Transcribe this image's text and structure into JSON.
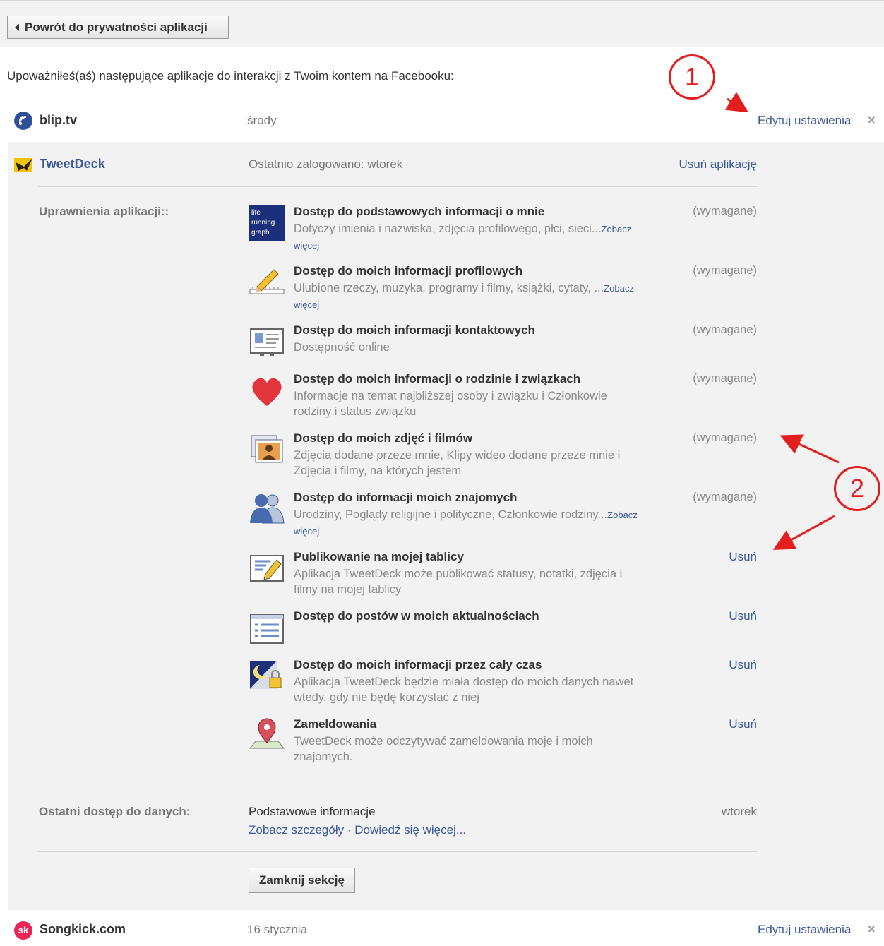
{
  "back_button": "Powrót do prywatności aplikacji",
  "intro": "Upoważniłeś(aś) następujące aplikacje do interakcji z Twoim kontem na Facebooku:",
  "apps": {
    "blip": {
      "icon": "blip-logo-icon",
      "name": "blip.tv",
      "last": "środy",
      "edit": "Edytuj ustawienia",
      "close": "×"
    },
    "tweetdeck": {
      "icon": "tweetdeck-logo-icon",
      "name": "TweetDeck",
      "last": "Ostatnio zalogowano: wtorek",
      "remove": "Usuń aplikację"
    },
    "songkick": {
      "icon": "songkick-logo-icon",
      "icon_text": "sk",
      "name": "Songkick.com",
      "last": "16 stycznia",
      "edit": "Edytuj ustawienia",
      "close": "×"
    }
  },
  "permissions_label": "Uprawnienia aplikacji::",
  "permissions": [
    {
      "icon": "life-running-graph-icon",
      "title": "Dostęp do podstawowych informacji o mnie",
      "desc": "Dotyczy imienia i nazwiska, zdjęcia profilowego, płci, sieci...",
      "more": "Zobacz więcej",
      "status": "(wymagane)"
    },
    {
      "icon": "pencil-ruler-icon",
      "title": "Dostęp do moich informacji profilowych",
      "desc": "Ulubione rzeczy, muzyka, programy i filmy, książki, cytaty, ...",
      "more": "Zobacz więcej",
      "status": "(wymagane)"
    },
    {
      "icon": "contact-card-icon",
      "title": "Dostęp do moich informacji kontaktowych",
      "desc": "Dostępność online",
      "more": "",
      "status": "(wymagane)"
    },
    {
      "icon": "heart-icon",
      "title": "Dostęp do moich informacji o rodzinie i związkach",
      "desc": "Informacje na temat najbliższej osoby i związku i Członkowie rodziny i status związku",
      "more": "",
      "status": "(wymagane)"
    },
    {
      "icon": "photos-icon",
      "title": "Dostęp do moich zdjęć i filmów",
      "desc": "Zdjęcia dodane przeze mnie, Klipy wideo dodane przeze mnie i Zdjęcia i filmy, na których jestem",
      "more": "",
      "status": "(wymagane)"
    },
    {
      "icon": "friends-icon",
      "title": "Dostęp do informacji moich znajomych",
      "desc": "Urodziny, Poglądy religijne i polityczne, Członkowie rodziny...",
      "more": "Zobacz więcej",
      "status": "(wymagane)"
    },
    {
      "icon": "wall-post-icon",
      "title": "Publikowanie na mojej tablicy",
      "desc": "Aplikacja TweetDeck może publikować statusy, notatki, zdjęcia i filmy na mojej tablicy",
      "more": "",
      "action": "Usuń"
    },
    {
      "icon": "news-feed-icon",
      "title": "Dostęp do postów w moich aktualnościach",
      "desc": "",
      "more": "",
      "action": "Usuń"
    },
    {
      "icon": "offline-access-icon",
      "title": "Dostęp do moich informacji przez cały czas",
      "desc": "Aplikacja TweetDeck będzie miała dostęp do moich danych nawet wtedy, gdy nie będę korzystać z niej",
      "more": "",
      "action": "Usuń"
    },
    {
      "icon": "map-pin-icon",
      "title": "Zameldowania",
      "desc": "TweetDeck może odczytywać zameldowania moje i moich znajomych.",
      "more": "",
      "action": "Usuń"
    }
  ],
  "last_access": {
    "label": "Ostatni dostęp do danych:",
    "value": "Podstawowe informacje",
    "details_link": "Zobacz szczegóły",
    "separator": " · ",
    "learn_link": "Dowiedź się więcej...",
    "when": "wtorek"
  },
  "close_section": "Zamknij sekcję",
  "annotations": [
    "1",
    "2"
  ],
  "colors": {
    "link": "#3b5998",
    "annotation": "#e41e1e",
    "panel": "#f2f2f2"
  },
  "icon_text": {
    "life_graph": [
      "life",
      "running",
      "graph"
    ]
  }
}
